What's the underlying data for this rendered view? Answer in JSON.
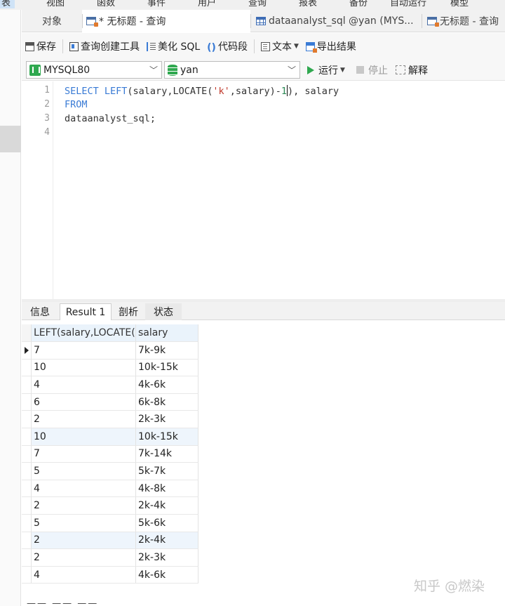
{
  "menu": {
    "items": [
      "表",
      "视图",
      "函数",
      "事件",
      "用户",
      "查询",
      "报表",
      "备份",
      "自动运行",
      "模型"
    ]
  },
  "tabs": [
    {
      "label": "对象"
    },
    {
      "label": "* 无标题 - 查询"
    },
    {
      "label": "dataanalyst_sql @yan (MYS..."
    },
    {
      "label": "无标题 - 查询"
    }
  ],
  "toolbar": {
    "save": "保存",
    "query_builder": "查询创建工具",
    "beautify": "美化 SQL",
    "code_snippet": "代码段",
    "code_glyph": "()",
    "text": "文本",
    "export": "导出结果"
  },
  "connection": {
    "server": "MYSQL80",
    "database": "yan",
    "run": "运行",
    "stop": "停止",
    "explain": "解释"
  },
  "editor": {
    "line_numbers": [
      "1",
      "2",
      "3",
      "4"
    ],
    "line1": {
      "kw1": "SELECT",
      "fn": " LEFT",
      "a": "(salary,LOCATE(",
      "s": "'k'",
      "b": ",salary)-",
      "n": "1",
      "c": "), salary"
    },
    "line2": "FROM",
    "line3": "dataanalyst_sql;"
  },
  "result_tabs": [
    "信息",
    "Result 1",
    "剖析",
    "状态"
  ],
  "grid": {
    "columns": [
      "LEFT(salary,LOCATE(",
      "salary"
    ],
    "rows": [
      [
        "7",
        "7k-9k"
      ],
      [
        "10",
        "10k-15k"
      ],
      [
        "4",
        "4k-6k"
      ],
      [
        "6",
        "6k-8k"
      ],
      [
        "2",
        "2k-3k"
      ],
      [
        "10",
        "10k-15k"
      ],
      [
        "7",
        "7k-14k"
      ],
      [
        "5",
        "5k-7k"
      ],
      [
        "4",
        "4k-8k"
      ],
      [
        "2",
        "2k-4k"
      ],
      [
        "5",
        "5k-6k"
      ],
      [
        "2",
        "2k-4k"
      ],
      [
        "2",
        "2k-3k"
      ],
      [
        "4",
        "4k-6k"
      ]
    ]
  },
  "watermark": "知乎 @燃染"
}
